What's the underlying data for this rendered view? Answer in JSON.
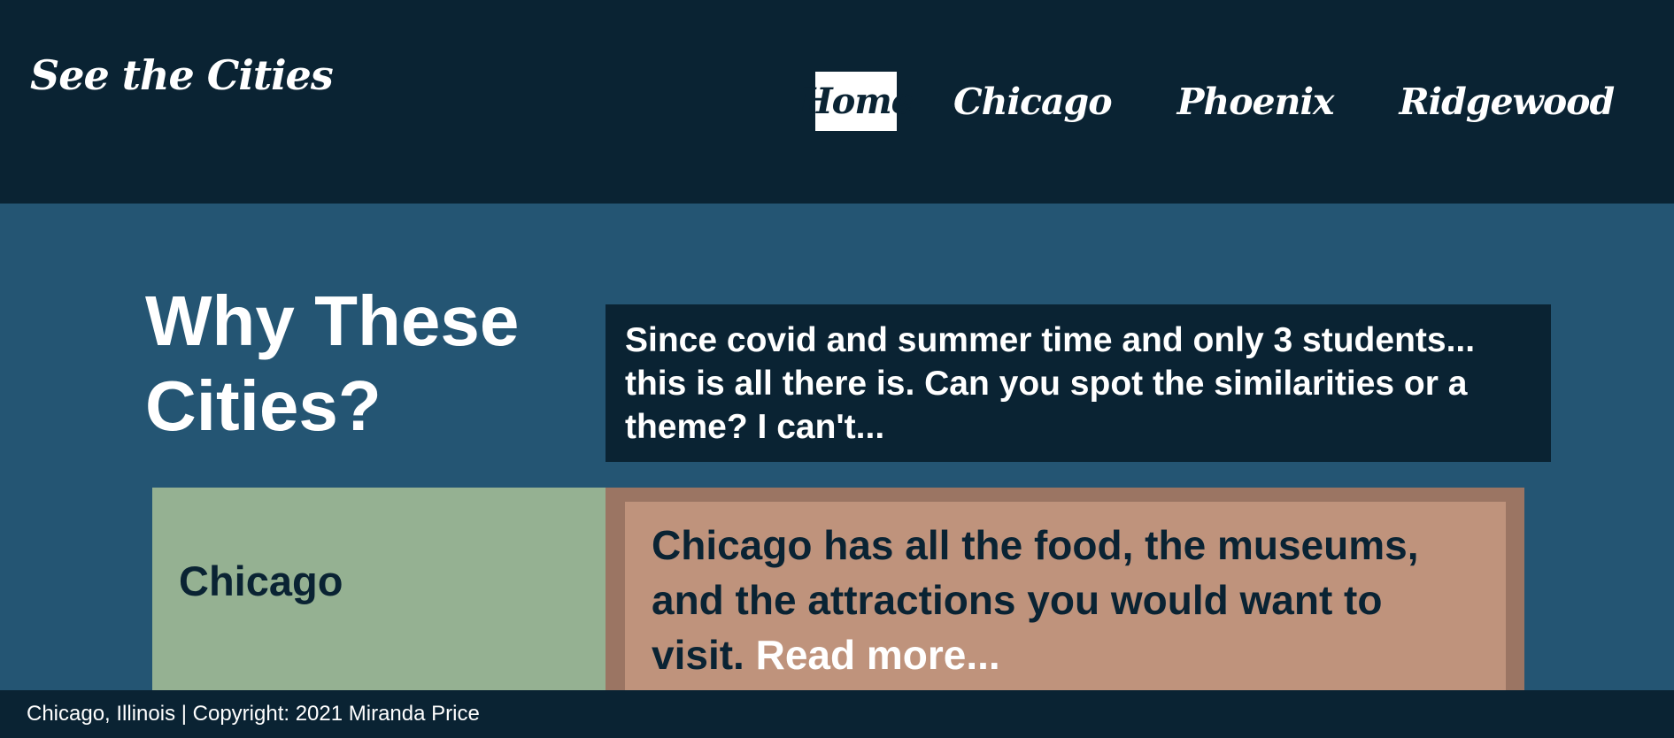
{
  "header": {
    "logo": "See the Cities",
    "nav": [
      {
        "label": "Home",
        "active": true
      },
      {
        "label": "Chicago",
        "active": false
      },
      {
        "label": "Phoenix",
        "active": false
      },
      {
        "label": "Ridgewood",
        "active": false
      }
    ]
  },
  "intro": {
    "title": "Why These Cities?",
    "text": "Since covid and summer time and only 3 students... this is all there is. Can you spot the similarities or a theme? I can't..."
  },
  "cities": [
    {
      "name": "Chicago",
      "description": "Chicago has all the food, the museums, and the attractions you would want to visit.",
      "read_more": "Read more..."
    }
  ],
  "footer": {
    "text": "Chicago, Illinois | Copyright: 2021 Miranda Price"
  },
  "colors": {
    "header_bg": "#0a2333",
    "page_bg": "#245573",
    "city_name_bg": "#95b192",
    "city_desc_outer": "#9b7563",
    "city_desc_inner": "#bf937c"
  }
}
